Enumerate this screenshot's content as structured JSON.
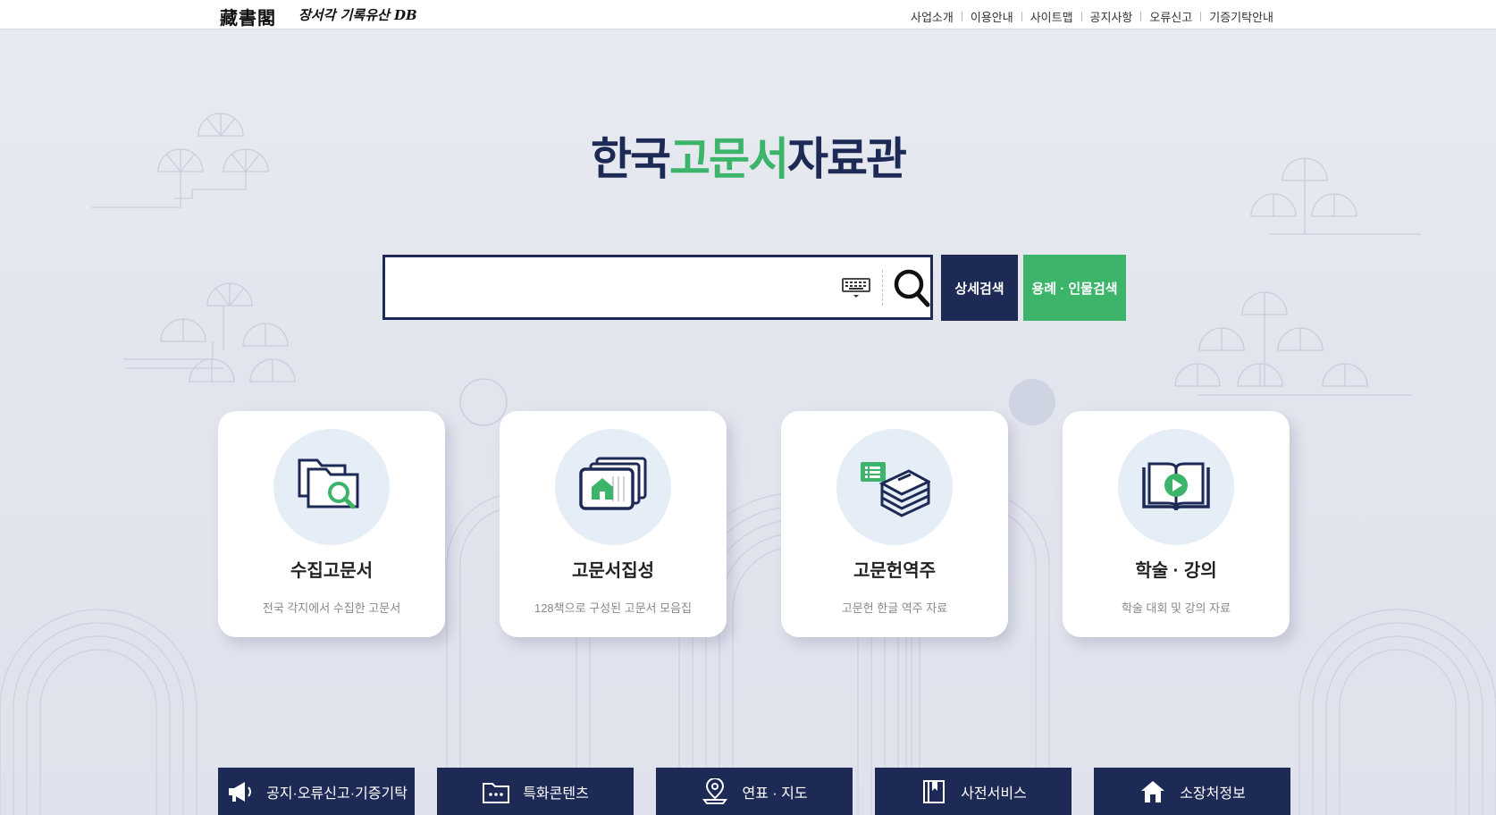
{
  "header": {
    "logo_hanja": "藏書閣",
    "logo_sub": "장서각 기록유산 DB",
    "nav": [
      "사업소개",
      "이용안내",
      "사이트맵",
      "공지사항",
      "오류신고",
      "기증기탁안내"
    ]
  },
  "title": {
    "part1": "한국",
    "part2": "고문서",
    "part3": "자료관"
  },
  "search": {
    "value": "",
    "detail_label": "상세검색",
    "term_label": "용례 · 인물검색"
  },
  "cards": [
    {
      "title": "수집고문서",
      "desc": "전국 각지에서 수집한 고문서",
      "icon": "folder-search-icon"
    },
    {
      "title": "고문서집성",
      "desc": "128책으로 구성된 고문서 모음집",
      "icon": "document-collection-icon"
    },
    {
      "title": "고문헌역주",
      "desc": "고문헌 한글 역주 자료",
      "icon": "book-stack-icon"
    },
    {
      "title": "학술 · 강의",
      "desc": "학술 대회 및 강의 자료",
      "icon": "book-play-icon"
    }
  ],
  "bottom_links": [
    {
      "label": "공지·오류신고·기증기탁",
      "icon": "megaphone-icon"
    },
    {
      "label": "특화콘텐츠",
      "icon": "folder-dots-icon"
    },
    {
      "label": "연표 · 지도",
      "icon": "map-pin-icon"
    },
    {
      "label": "사전서비스",
      "icon": "bookmark-book-icon"
    },
    {
      "label": "소장처정보",
      "icon": "home-icon"
    }
  ],
  "colors": {
    "navy": "#1e2a56",
    "green": "#3cb46a",
    "card_circle": "#e5edf6"
  }
}
